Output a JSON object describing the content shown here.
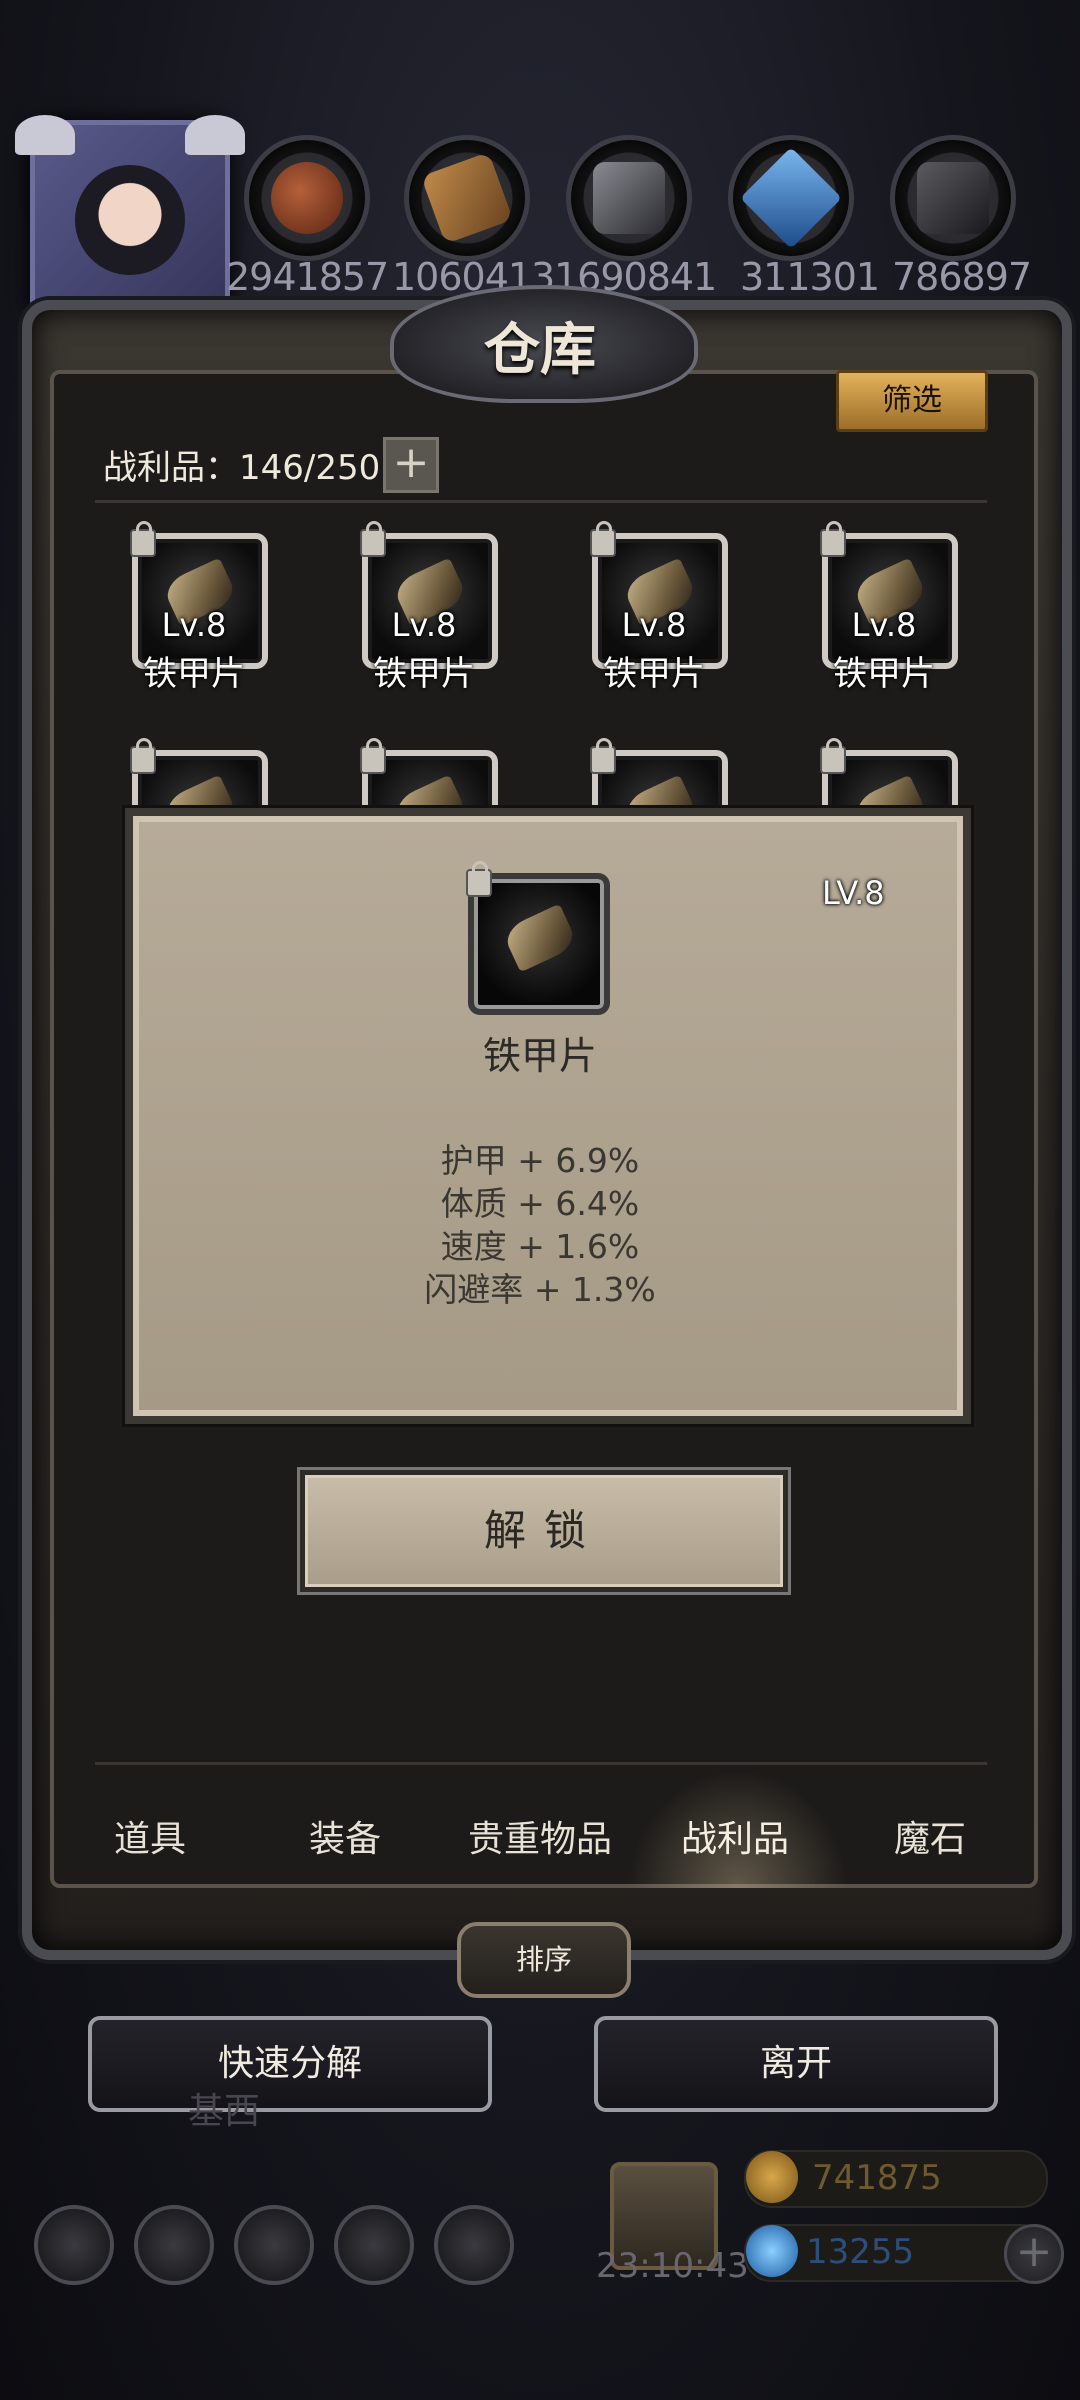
{
  "resources": [
    "2941857",
    "1060413",
    "1690841",
    "311301",
    "786897"
  ],
  "warehouse": {
    "title": "仓库",
    "filter_label": "筛选",
    "count_label": "战利品：146/250",
    "plus_label": "+"
  },
  "items": [
    {
      "level": "Lv.8",
      "name": "铁甲片"
    },
    {
      "level": "Lv.8",
      "name": "铁甲片"
    },
    {
      "level": "Lv.8",
      "name": "铁甲片"
    },
    {
      "level": "Lv.8",
      "name": "铁甲片"
    }
  ],
  "detail": {
    "level": "LV.8",
    "name": "铁甲片",
    "stats": [
      "护甲 + 6.9%",
      "体质 + 6.4%",
      "速度 + 1.6%",
      "闪避率 + 1.3%"
    ],
    "unlock_label": "解锁"
  },
  "tabs": [
    "道具",
    "装备",
    "贵重物品",
    "战利品",
    "魔石"
  ],
  "active_tab": "战利品",
  "sort_label": "排序",
  "buttons": {
    "quick_decompose": "快速分解",
    "leave": "离开"
  },
  "background": {
    "ghost_text": "基西",
    "timer": "23:10:43",
    "gold": "741875",
    "gems": "13255"
  },
  "colors": {
    "filter_button": "#c8913e",
    "panel_paper": "#b0a591",
    "frame_metal": "#4b4b52"
  }
}
